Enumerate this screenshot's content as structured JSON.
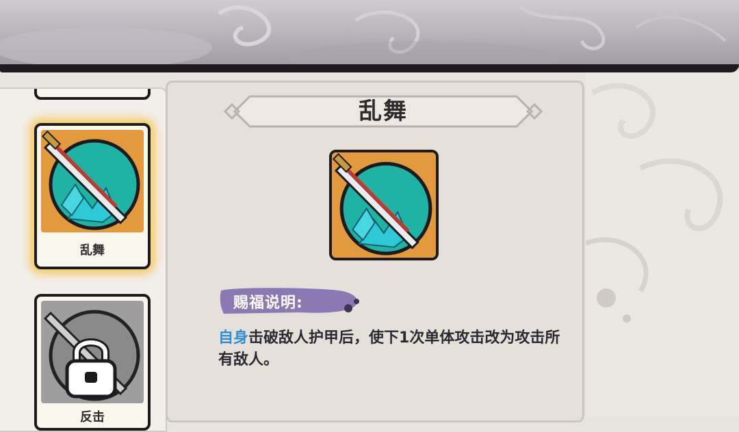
{
  "skill_list": {
    "items": [
      {
        "label": ""
      },
      {
        "label": "乱舞",
        "state": "selected",
        "icon": "sword-skill-icon"
      },
      {
        "label": "反击",
        "state": "locked",
        "icon": "lock-icon"
      }
    ]
  },
  "detail": {
    "title": "乱舞",
    "icon": "sword-skill-icon",
    "section_label": "赐福说明:",
    "description": {
      "keyword": "自身",
      "text": "击破敌人护甲后，使下1次单体攻击改为攻击所有敌人。"
    }
  },
  "colors": {
    "keyword": "#2f8fd6",
    "tag": "#8c78b3",
    "icon_bg": "#e39a3c",
    "icon_circle": "#1fb3a6",
    "selected_glow": "#f3c45a"
  }
}
